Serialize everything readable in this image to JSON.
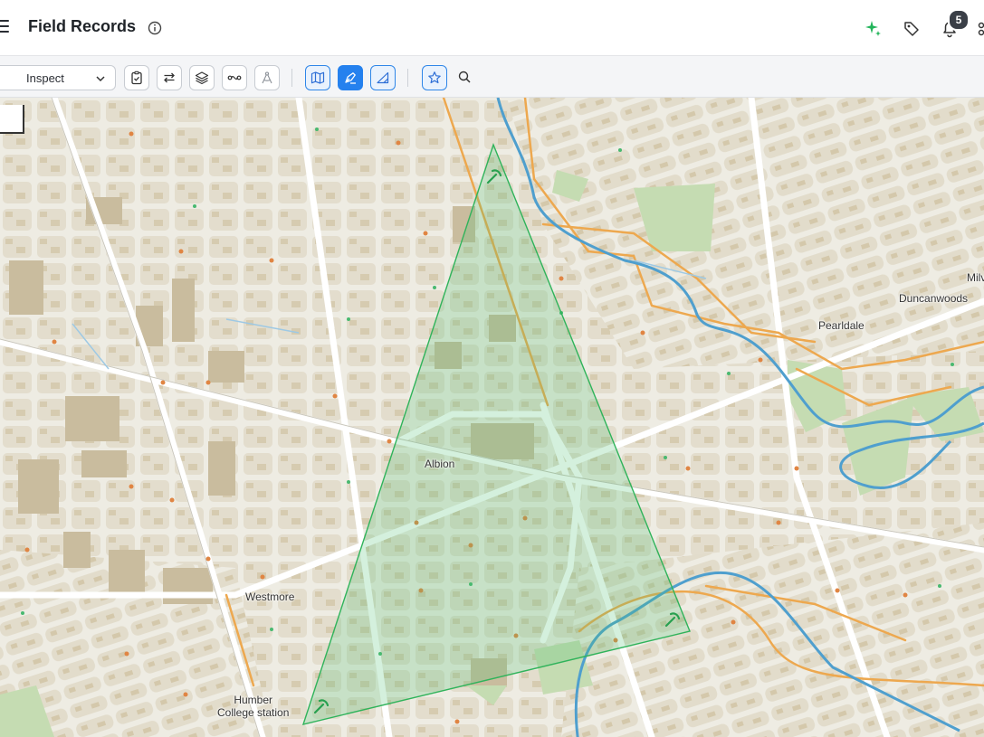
{
  "header": {
    "title": "Field Records",
    "notification_count": "5"
  },
  "toolbar": {
    "mode_select": {
      "value": "Inspect"
    },
    "tools": [
      {
        "name": "checklist-tool",
        "icon": "clipboard-check-icon"
      },
      {
        "name": "swap-tool",
        "icon": "arrows-swap-icon"
      },
      {
        "name": "layers-tool",
        "icon": "layers-icon"
      },
      {
        "name": "route-tool",
        "icon": "route-icon"
      },
      {
        "name": "measure-tool",
        "icon": "compass-icon"
      },
      {
        "name": "map-view-tool",
        "icon": "map-icon",
        "state": "selected"
      },
      {
        "name": "draw-polygon-tool",
        "icon": "pen-tool-icon",
        "state": "active"
      },
      {
        "name": "draw-triangle-tool",
        "icon": "ruler-triangle-icon",
        "state": "selected"
      },
      {
        "name": "favorites-tool",
        "icon": "star-icon",
        "state": "selected"
      },
      {
        "name": "search-tool",
        "icon": "search-icon"
      }
    ]
  },
  "map": {
    "places": [
      {
        "label": "Albion"
      },
      {
        "label": "Westmore"
      },
      {
        "label": "Humber\nCollege station"
      },
      {
        "label": "Pearldale"
      },
      {
        "label": "Duncanwoods"
      },
      {
        "label": "Milv"
      }
    ],
    "polygon": {
      "fill": "#4cc26f",
      "stroke": "#2fb35a",
      "vertex_icon": "pickaxe-icon"
    },
    "colors": {
      "land": "#eeece3",
      "road": "#ffffff",
      "block": "#ddd6c5",
      "building": "#c9bc9e",
      "park": "#c5dcb2",
      "river": "#4f9fce",
      "major_road": "#eda84f"
    }
  }
}
